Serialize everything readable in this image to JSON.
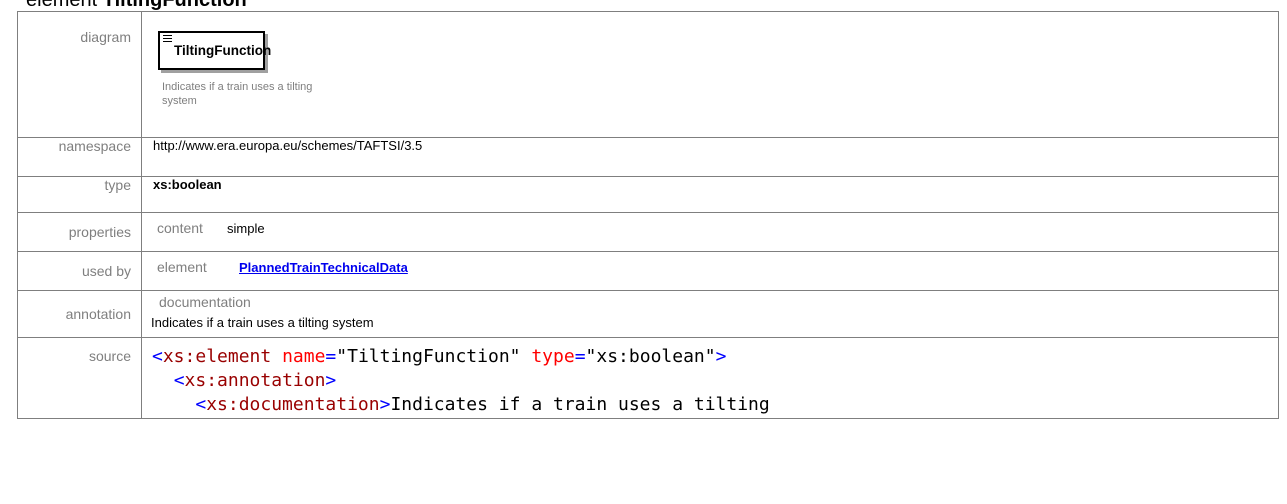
{
  "heading": {
    "prefix": "element ",
    "name": "TiltingFunction"
  },
  "rows": {
    "diagram": {
      "label": "diagram",
      "box_name": "TiltingFunction",
      "doc": "Indicates if a train uses a tilting system"
    },
    "namespace": {
      "label": "namespace",
      "value": "http://www.era.europa.eu/schemes/TAFTSI/3.5"
    },
    "type": {
      "label": "type",
      "value": "xs:boolean"
    },
    "properties": {
      "label": "properties",
      "key": "content",
      "value": "simple"
    },
    "used_by": {
      "label": "used by",
      "key": "element",
      "link": "PlannedTrainTechnicalData"
    },
    "annotation": {
      "label": "annotation",
      "key": "documentation",
      "value": "Indicates if a train uses a tilting system"
    },
    "source": {
      "label": "source",
      "line1": {
        "open": "<",
        "tag": "xs:element",
        "attr1": "name",
        "eq": "=",
        "val1": "\"TiltingFunction\"",
        "attr2": "type",
        "val2": "\"xs:boolean\"",
        "close": ">"
      },
      "line2": {
        "indent": "  ",
        "open": "<",
        "tag": "xs:annotation",
        "close": ">"
      },
      "line3": {
        "indent": "    ",
        "open": "<",
        "tag": "xs:documentation",
        "close": ">",
        "text": "Indicates if a train uses a tilting"
      }
    }
  },
  "colors": {
    "label_gray": "#7f7f7f",
    "link": "#0000ee",
    "xml_tag": "#990000",
    "xml_bracket": "#0000ff",
    "xml_attr": "#ff0000"
  }
}
